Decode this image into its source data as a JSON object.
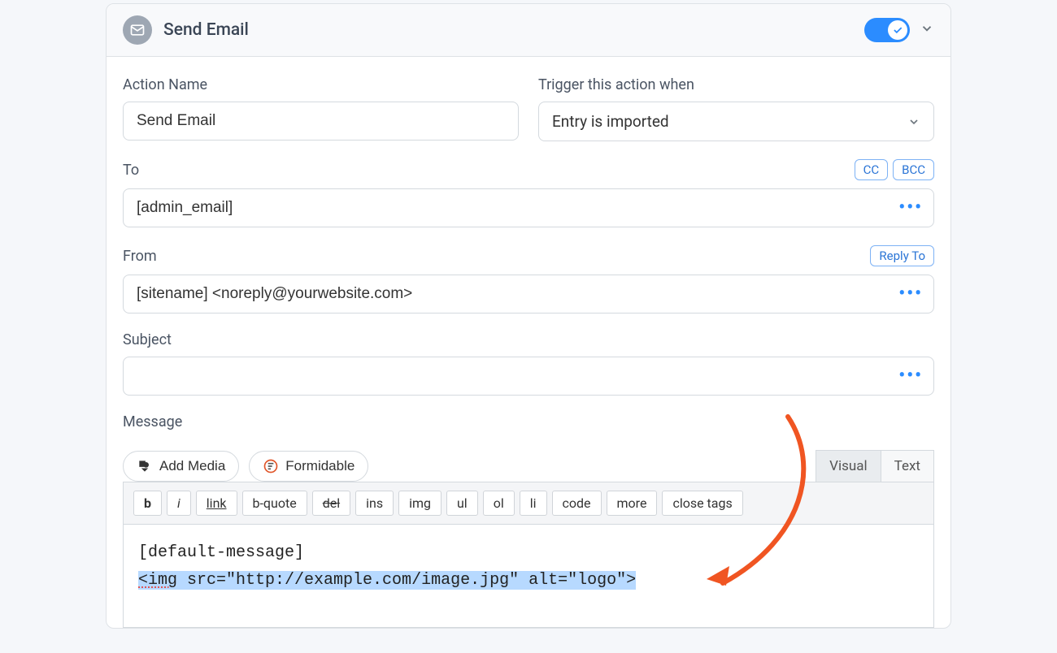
{
  "header": {
    "title": "Send Email"
  },
  "fields": {
    "action_name": {
      "label": "Action Name",
      "value": "Send Email"
    },
    "trigger": {
      "label": "Trigger this action when",
      "value": "Entry is imported"
    },
    "to": {
      "label": "To",
      "value": "[admin_email]",
      "cc": "CC",
      "bcc": "BCC"
    },
    "from": {
      "label": "From",
      "value": "[sitename] <noreply@yourwebsite.com>",
      "reply_to": "Reply To"
    },
    "subject": {
      "label": "Subject",
      "value": ""
    },
    "message": {
      "label": "Message"
    }
  },
  "editor": {
    "add_media": "Add Media",
    "formidable": "Formidable",
    "tab_visual": "Visual",
    "tab_text": "Text",
    "toolbar": {
      "b": "b",
      "i": "i",
      "link": "link",
      "bquote": "b-quote",
      "del": "del",
      "ins": "ins",
      "img": "img",
      "ul": "ul",
      "ol": "ol",
      "li": "li",
      "code": "code",
      "more": "more",
      "close": "close tags"
    },
    "content_line1": "[default-message]",
    "content_line2": "<img src=\"http://example.com/image.jpg\" alt=\"logo\">"
  }
}
